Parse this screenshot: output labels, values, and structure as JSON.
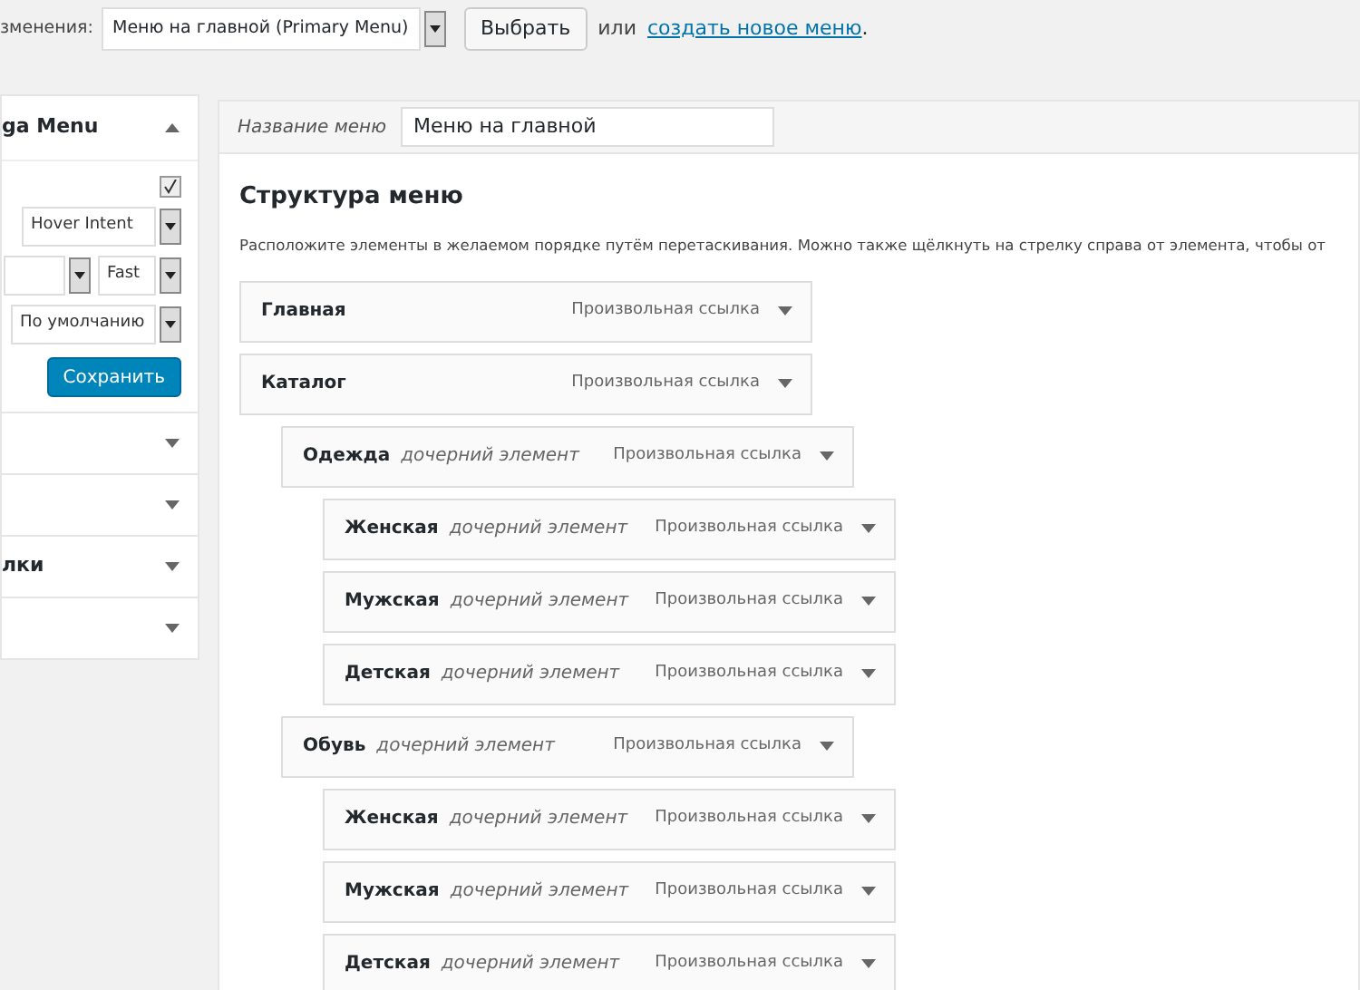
{
  "top_bar": {
    "label": "зменения:",
    "menu_select": "Меню на главной (Primary Menu)",
    "select_button": "Выбрать",
    "or_text": "или",
    "create_link": "создать новое меню",
    "link_end": "."
  },
  "sidebar": {
    "title": "ga Menu",
    "expanded": true,
    "checkbox": {
      "checked": true
    },
    "selects": [
      {
        "kind": "select",
        "value": "Hover Intent"
      },
      {
        "kind": "pair",
        "second": "Fast"
      },
      {
        "kind": "select",
        "value": "По умолчанию"
      }
    ],
    "save_button": "Сохранить",
    "sections": [
      {
        "expanded": false
      },
      {
        "expanded": false
      },
      {
        "title": "лки",
        "expanded": false
      },
      {
        "expanded": false
      }
    ]
  },
  "menu_name": {
    "label": "Название меню",
    "value": "Меню на главной"
  },
  "structure": {
    "heading": "Структура меню",
    "description": "Расположите элементы в желаемом порядке путём перетаскивания. Можно также щёлкнуть на стрелку справа от элемента, чтобы от",
    "items": [
      {
        "title": "Главная",
        "type": "Произвольная ссылка"
      },
      {
        "title": "Каталог",
        "type": "Произвольная ссылка",
        "children": [
          {
            "title": "Одежда",
            "subtitle": "дочерний элемент",
            "type": "Произвольная ссылка",
            "children": [
              {
                "title": "Женская",
                "subtitle": "дочерний элемент",
                "type": "Произвольная ссылка"
              },
              {
                "title": "Мужская",
                "subtitle": "дочерний элемент",
                "type": "Произвольная ссылка"
              },
              {
                "title": "Детская",
                "subtitle": "дочерний элемент",
                "type": "Произвольная ссылка"
              }
            ]
          },
          {
            "title": "Обувь",
            "subtitle": "дочерний элемент",
            "type": "Произвольная ссылка",
            "children": [
              {
                "title": "Женская",
                "subtitle": "дочерний элемент",
                "type": "Произвольная ссылка"
              },
              {
                "title": "Мужская",
                "subtitle": "дочерний элемент",
                "type": "Произвольная ссылка"
              },
              {
                "title": "Детская",
                "subtitle": "дочерний элемент",
                "type": "Произвольная ссылка"
              }
            ]
          }
        ]
      }
    ]
  }
}
